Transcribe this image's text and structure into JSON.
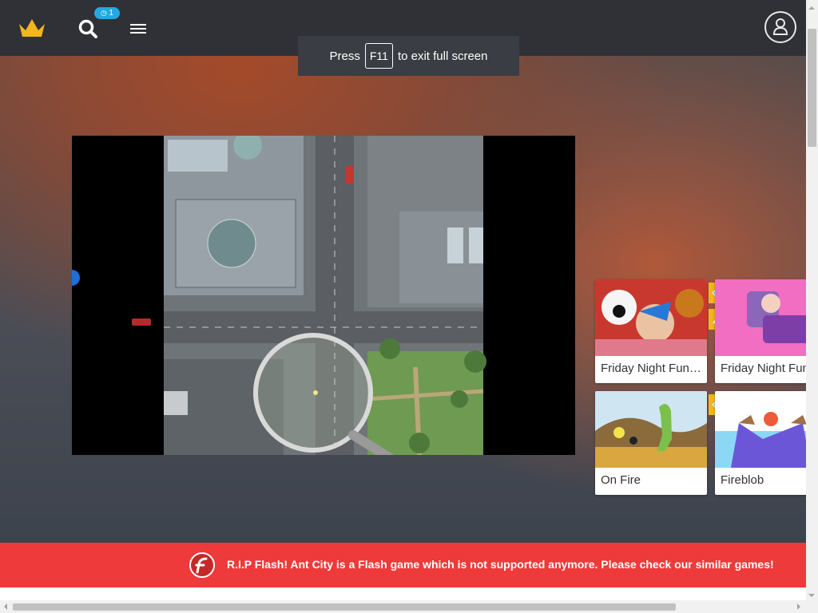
{
  "header": {
    "logo_icon": "crown-icon",
    "search_icon": "search-icon",
    "notification_badge": "1",
    "menu_icon": "hamburger-icon",
    "user_icon": "user-icon"
  },
  "fullscreen_tip": {
    "before": "Press",
    "key": "F11",
    "after": "to exit full screen"
  },
  "game": {
    "name": "Ant City"
  },
  "similar_games": [
    {
      "title": "Friday Night Funkin' vs Cuphead"
    },
    {
      "title": "Friday Night Funkin'"
    },
    {
      "title": "On Fire"
    },
    {
      "title": "Fireblob"
    }
  ],
  "banner": {
    "icon": "flash-icon",
    "text": "R.I.P Flash! Ant City is a Flash game which is not supported anymore. Please check our similar games!"
  },
  "colors": {
    "banner": "#ee3a3a",
    "header": "#2f3136",
    "accent": "#f3b51e",
    "badge": "#23a9e1"
  }
}
